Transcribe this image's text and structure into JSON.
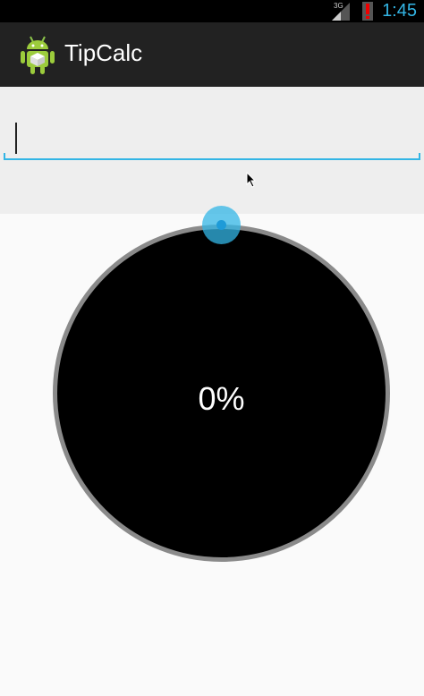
{
  "status_bar": {
    "network_type": "3G",
    "time": "1:45",
    "icons": [
      "signal-icon",
      "alert-icon"
    ],
    "accent_color": "#33b5e5"
  },
  "action_bar": {
    "title": "TipCalc",
    "icon": "android-app-icon"
  },
  "bill_input": {
    "value": "",
    "placeholder": ""
  },
  "tip_dial": {
    "percent_label": "0%",
    "value_percent": 0,
    "accent_color": "#33b5e5"
  }
}
